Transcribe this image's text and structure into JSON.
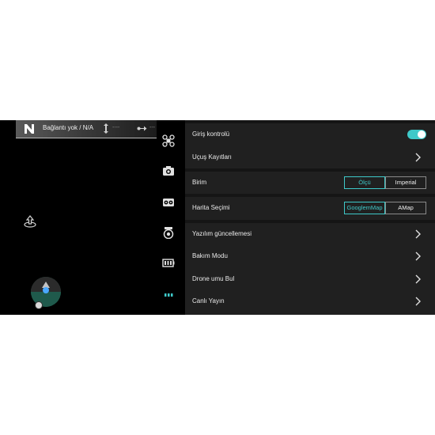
{
  "status": {
    "connection": "Bağlantı yok / N/A",
    "altitude": "----",
    "distance": "---"
  },
  "rail_icons": [
    "drone-icon",
    "camera-icon",
    "video-recorder-icon",
    "gimbal-camera-icon",
    "battery-icon",
    "more-dots-icon"
  ],
  "settings": {
    "flight_control": {
      "label": "Giriş kontrolü",
      "toggle_on": true
    },
    "flight_logs": {
      "label": "Uçuş Kayıtları"
    },
    "unit": {
      "label": "Birim",
      "options": [
        "Ölçü",
        "Imperial"
      ],
      "selected": "Ölçü"
    },
    "map": {
      "label": "Harita Seçimi",
      "options": [
        "GooglemMap",
        "AMap"
      ],
      "selected": "GooglemMap"
    },
    "software_update": {
      "label": "Yazılım güncellemesi"
    },
    "maintenance": {
      "label": "Bakım Modu"
    },
    "find_drone": {
      "label": "Drone umu Bul"
    },
    "live": {
      "label": "Canlı Yayın"
    }
  },
  "colors": {
    "accent": "#3ec9c9",
    "panel_bg": "#151515",
    "row_bg": "#202020"
  }
}
